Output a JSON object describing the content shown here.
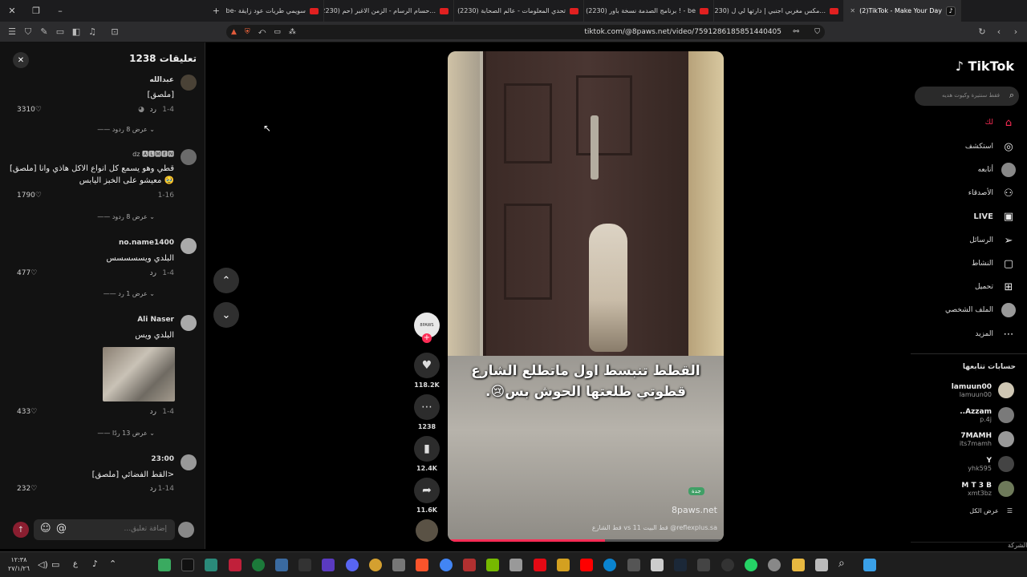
{
  "tabs": [
    {
      "label": "be- سويمي طريات عود زايقة"
    },
    {
      "label": "(2230) حسام الرسام - الزمن الاغبر (حم..."
    },
    {
      "label": "(2230) تحدي المعلومات - عالم الصحابة"
    },
    {
      "label": "(2230) برنامج الصدمة نسخة باور ! - be"
    },
    {
      "label": "(2230) مكس مغربي اجنبي | دارتها لي ل..."
    },
    {
      "label": "(2)TikTok - Make Your Day"
    }
  ],
  "url": "tiktok.com/@8paws.net/video/7591286185851440405",
  "comments": {
    "title": "تعليقات 1238",
    "items": [
      {
        "name": "عبدالله",
        "text": "[ملصق]",
        "date": "1-4",
        "reply": "رد",
        "likes": "3310",
        "replies": "عرض 8 ردود"
      },
      {
        "name": "dz 🅰🅻🅼🅴🅽",
        "text": "[ملصق] قطي وهو يسمع كل انواع الاكل هاذي وانا معيشو على الخبز اليابس 🥹",
        "date": "1-16",
        "reply": "رد",
        "likes": "1790",
        "replies": "عرض 8 ردود"
      },
      {
        "name": "no.name1400",
        "text": "البلدي ويسسسسس",
        "date": "1-4",
        "reply": "رد",
        "likes": "477",
        "replies": "عرض 1 رد"
      },
      {
        "name": "Ali Naser",
        "text": "البلدي ويس",
        "date": "1-4",
        "reply": "رد",
        "likes": "433",
        "replies": "عرض 13 ردًا"
      },
      {
        "name": "23:00",
        "text": "[ملصق] القط الفضائي>",
        "date": "1-14",
        "reply": "رد",
        "likes": "232"
      }
    ],
    "input_placeholder": "إضافة تعليق..."
  },
  "video": {
    "caption_line1": "القطط تنبسط اول ماتطلع الشارع",
    "caption_line2": "قطوتي طلعتها الحوش بس😢.",
    "watermark": "8paws.net",
    "bottom_text": "reflexplus.sa@ قط البيت 11 vs قط الشارع",
    "badge": "جدة"
  },
  "actions": {
    "avatar_label": "8PAWS",
    "likes": "118.2K",
    "comments": "1238",
    "saves": "12.4K",
    "shares": "11.6K"
  },
  "sidebar": {
    "logo": "TikTok",
    "search_placeholder": "فقط سنتيرة وكيوت هديه",
    "nav": [
      "لك",
      "استكشف",
      "أتابعه",
      "الأصدقاء",
      "LIVE",
      "الرسائل",
      "النشاط",
      "تحميل",
      "الملف الشخصي",
      "المزيد"
    ],
    "following_title": "حسابات تتابعها",
    "following": [
      {
        "name": "lamuun00",
        "user": "lamuun00"
      },
      {
        "name": "Azzam..",
        "user": "p.4j"
      },
      {
        "name": "7MAMH",
        "user": "its7mamh"
      },
      {
        "name": "Y",
        "user": "yhk595"
      },
      {
        "name": "M T 3 B",
        "user": "xmt3bz"
      }
    ],
    "see_all": "عرض الكل",
    "footer": "الشركة"
  },
  "taskbar": {
    "time": "١٢:٣٨",
    "date": "٢٧/١/٢٦",
    "lang": "ع"
  },
  "colors": {
    "accent": "#fe2c55",
    "panel": "#121212"
  }
}
